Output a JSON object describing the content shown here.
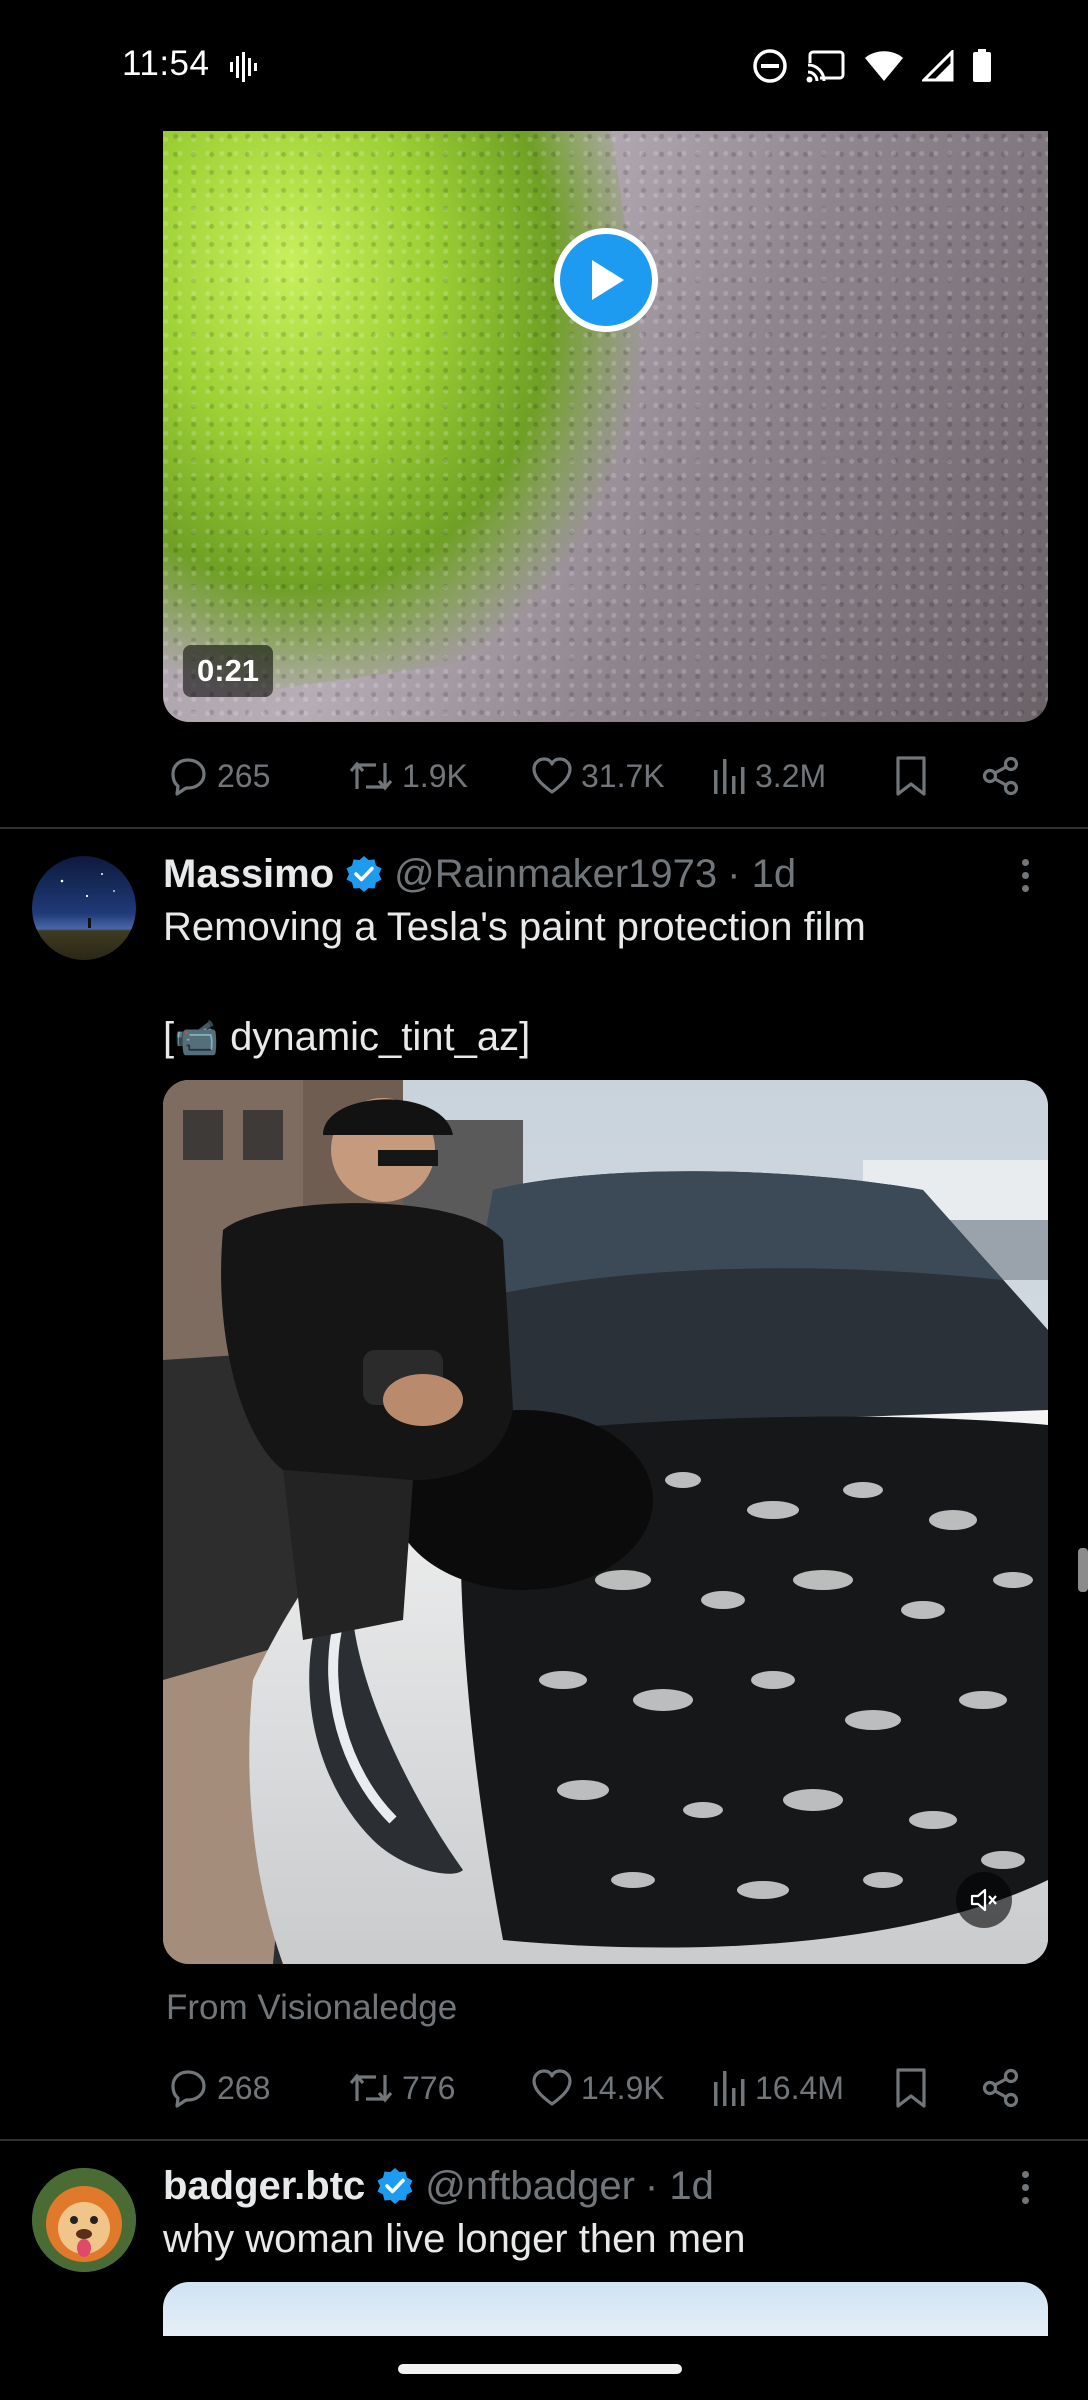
{
  "status_bar": {
    "time": "11:54",
    "icons": [
      "voicemail-icon",
      "do-not-disturb-icon",
      "cast-icon",
      "wifi-icon",
      "signal-icon",
      "battery-icon"
    ]
  },
  "tweet1": {
    "media": {
      "duration": "0:21",
      "play_icon": "play-icon"
    },
    "actions": {
      "replies": "265",
      "retweets": "1.9K",
      "likes": "31.7K",
      "views": "3.2M"
    }
  },
  "tweet2": {
    "display_name": "Massimo",
    "handle": "@Rainmaker1973",
    "time": "· 1d",
    "text_line1": "Removing a Tesla's paint protection film",
    "text_line2_prefix": "[",
    "text_line2": "dynamic_tint_az]",
    "camera_emoji": "📹",
    "from": "From Visionaledge",
    "actions": {
      "replies": "268",
      "retweets": "776",
      "likes": "14.9K",
      "views": "16.4M"
    }
  },
  "tweet3": {
    "display_name": "badger.btc",
    "handle": "@nftbadger",
    "time": "· 1d",
    "text": "why woman live longer then men"
  },
  "colors": {
    "background": "#000000",
    "text": "#e7e9ea",
    "secondary": "#71767b",
    "accent": "#1d9bf0",
    "divider": "#2f3336"
  }
}
